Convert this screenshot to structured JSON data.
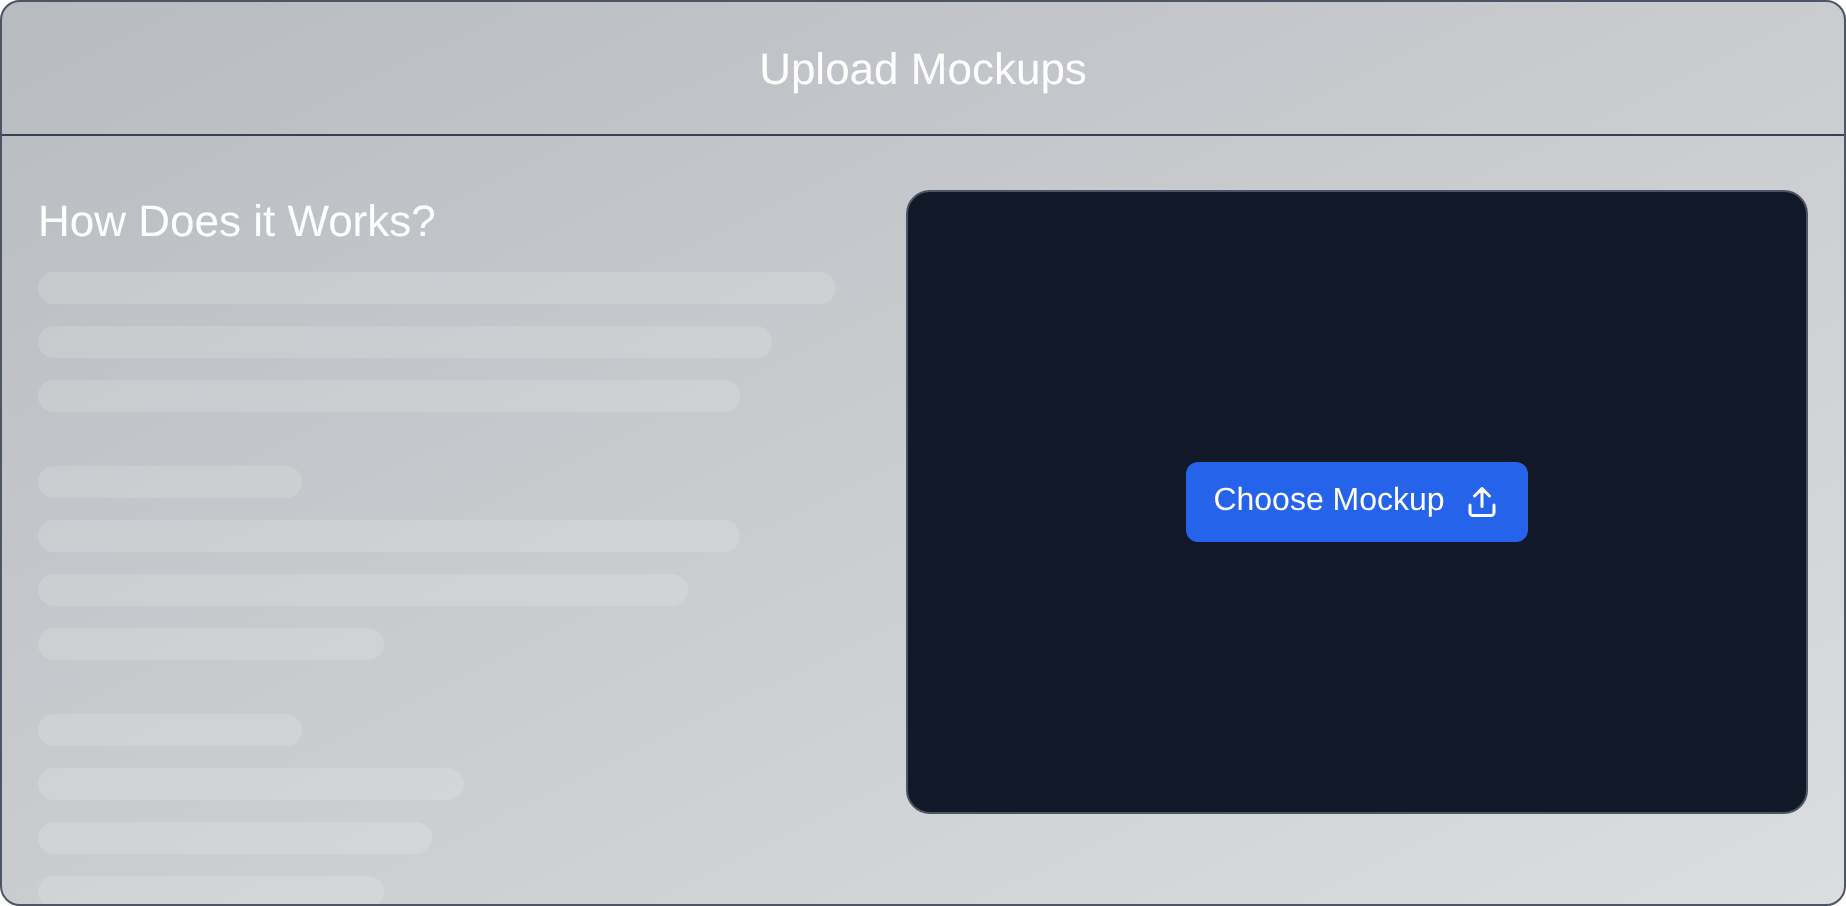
{
  "window": {
    "title": "Upload Mockups"
  },
  "guide": {
    "heading": "How Does it Works?"
  },
  "upload": {
    "button": "Choose Mockup"
  }
}
